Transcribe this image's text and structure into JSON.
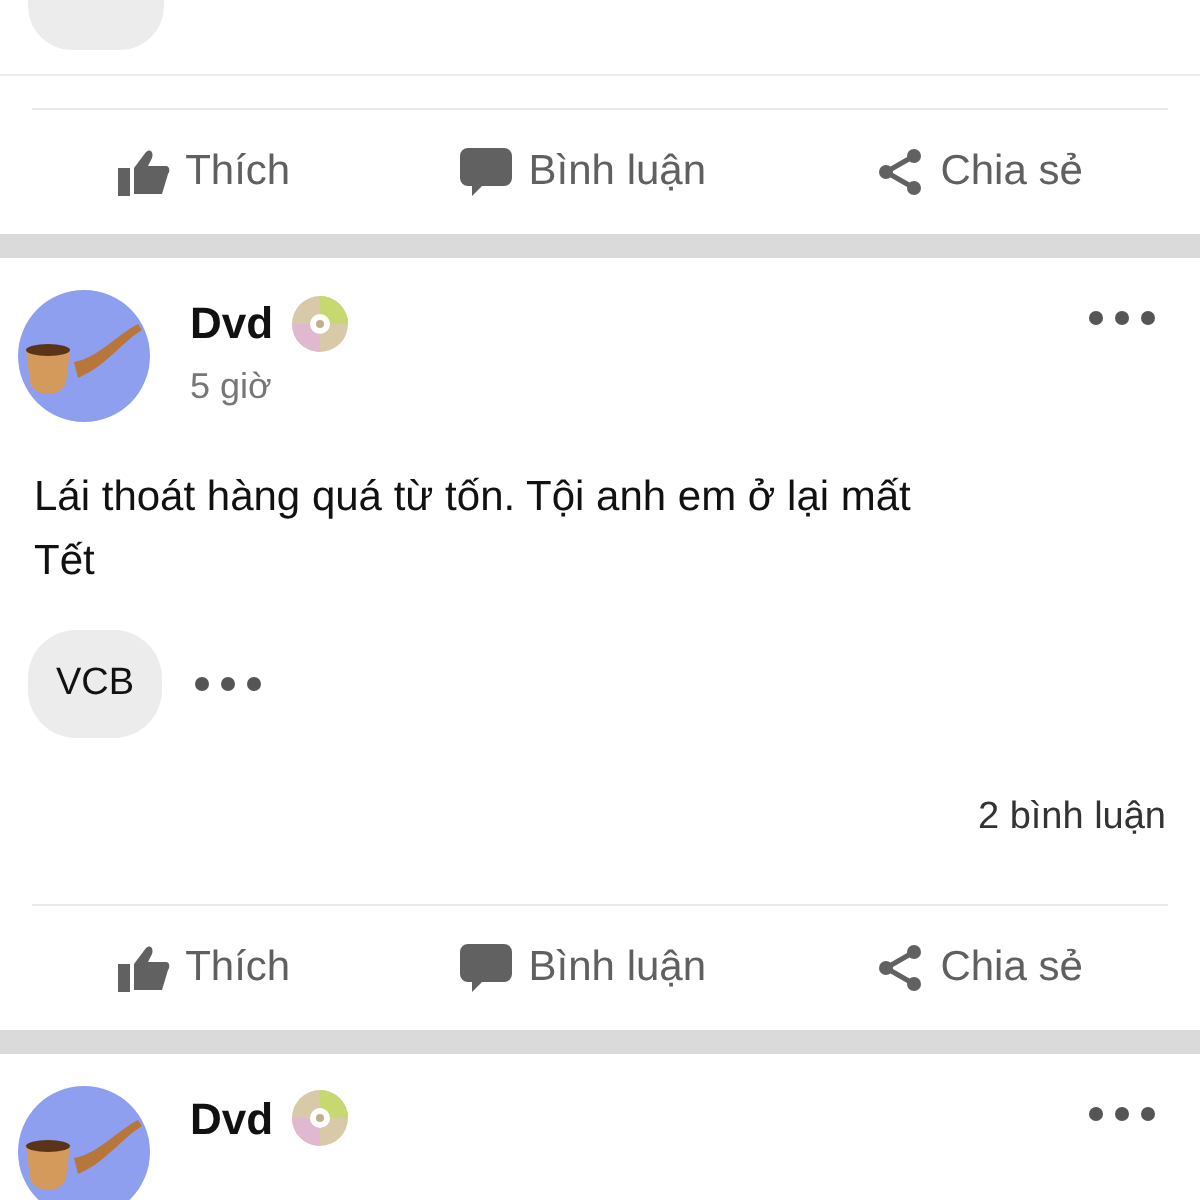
{
  "posts": [
    {
      "actions": [
        {
          "kind": "like",
          "label": "Thích"
        },
        {
          "kind": "comment",
          "label": "Bình luận"
        },
        {
          "kind": "share",
          "label": "Chia sẻ"
        }
      ]
    },
    {
      "author": "Dvd",
      "time": "5 giờ",
      "text": "Lái thoát hàng quá từ tốn. Tội anh em ở lại mất Tết",
      "tags": [
        "VCB"
      ],
      "comment_count": "2 bình luận",
      "actions": [
        {
          "kind": "like",
          "label": "Thích"
        },
        {
          "kind": "comment",
          "label": "Bình luận"
        },
        {
          "kind": "share",
          "label": "Chia sẻ"
        }
      ]
    },
    {
      "author": "Dvd"
    }
  ]
}
